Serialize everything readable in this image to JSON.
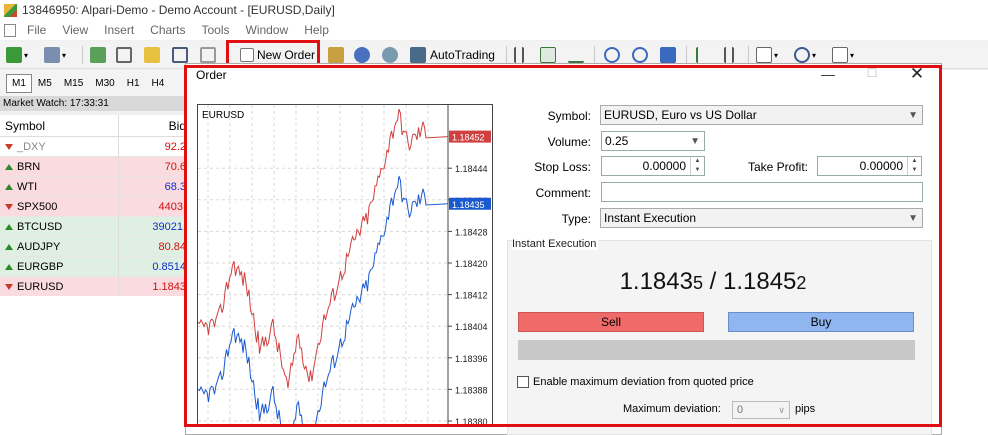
{
  "window": {
    "title": "13846950: Alpari-Demo - Demo Account - [EURUSD,Daily]"
  },
  "menu": [
    "File",
    "View",
    "Insert",
    "Charts",
    "Tools",
    "Window",
    "Help"
  ],
  "toolbar": {
    "new_order_label": "New Order",
    "autotrading_label": "AutoTrading"
  },
  "timeframes": [
    "M1",
    "M5",
    "M15",
    "M30",
    "H1",
    "H4"
  ],
  "market_watch": {
    "header": "Market Watch: 17:33:31",
    "col_symbol": "Symbol",
    "col_bid": "Bid",
    "rows": [
      {
        "symbol": "_DXY",
        "bid": "92.2",
        "dir": "down",
        "bg": "white",
        "color": "#888888",
        "bid_color": "#d01010"
      },
      {
        "symbol": "BRN",
        "bid": "70.6",
        "dir": "up",
        "bg": "pink",
        "color": "#000000",
        "bid_color": "#d01010"
      },
      {
        "symbol": "WTI",
        "bid": "68.3",
        "dir": "up",
        "bg": "pink",
        "color": "#000000",
        "bid_color": "#1030c8"
      },
      {
        "symbol": "SPX500",
        "bid": "4403.",
        "dir": "down",
        "bg": "pink",
        "color": "#000000",
        "bid_color": "#d01010"
      },
      {
        "symbol": "BTCUSD",
        "bid": "39021.",
        "dir": "up",
        "bg": "green",
        "color": "#000000",
        "bid_color": "#1030c8"
      },
      {
        "symbol": "AUDJPY",
        "bid": "80.84",
        "dir": "up",
        "bg": "green",
        "color": "#000000",
        "bid_color": "#d01010"
      },
      {
        "symbol": "EURGBP",
        "bid": "0.8514",
        "dir": "up",
        "bg": "green",
        "color": "#000000",
        "bid_color": "#1030c8"
      },
      {
        "symbol": "EURUSD",
        "bid": "1.1843",
        "dir": "down",
        "bg": "pink",
        "color": "#000000",
        "bid_color": "#d01010"
      }
    ]
  },
  "dialog": {
    "title": "Order",
    "minimize_glyph": "—",
    "maximize_glyph": "☐",
    "close_glyph": "✕",
    "symbol_label": "Symbol:",
    "symbol_value": "EURUSD, Euro vs US Dollar",
    "volume_label": "Volume:",
    "volume_value": "0.25",
    "stop_loss_label": "Stop Loss:",
    "stop_loss_value": "0.00000",
    "take_profit_label": "Take Profit:",
    "take_profit_value": "0.00000",
    "comment_label": "Comment:",
    "comment_value": "",
    "type_label": "Type:",
    "type_value": "Instant Execution",
    "group_label": "Instant Execution",
    "bid_main": "1.1843",
    "bid_small": "5",
    "separator": " / ",
    "ask_main": "1.1845",
    "ask_small": "2",
    "sell_label": "Sell",
    "buy_label": "Buy",
    "deviation_check_label": "Enable maximum deviation from quoted price",
    "max_deviation_label": "Maximum deviation:",
    "max_deviation_value": "0",
    "max_deviation_unit": "pips"
  },
  "chart": {
    "symbol": "EURUSD",
    "ask_tag": "1.18452",
    "bid_tag": "1.18435",
    "ask_color": "#d04040",
    "bid_color": "#1a5ad0",
    "price_ticks": [
      {
        "label": "1.18444",
        "value": 1.18444
      },
      {
        "label": "1.18436",
        "value": 1.18436
      },
      {
        "label": "1.18428",
        "value": 1.18428
      },
      {
        "label": "1.18420",
        "value": 1.1842
      },
      {
        "label": "1.18412",
        "value": 1.18412
      },
      {
        "label": "1.18404",
        "value": 1.18404
      },
      {
        "label": "1.18396",
        "value": 1.18396
      },
      {
        "label": "1.18388",
        "value": 1.18388
      },
      {
        "label": "1.18380",
        "value": 1.1838
      }
    ]
  }
}
